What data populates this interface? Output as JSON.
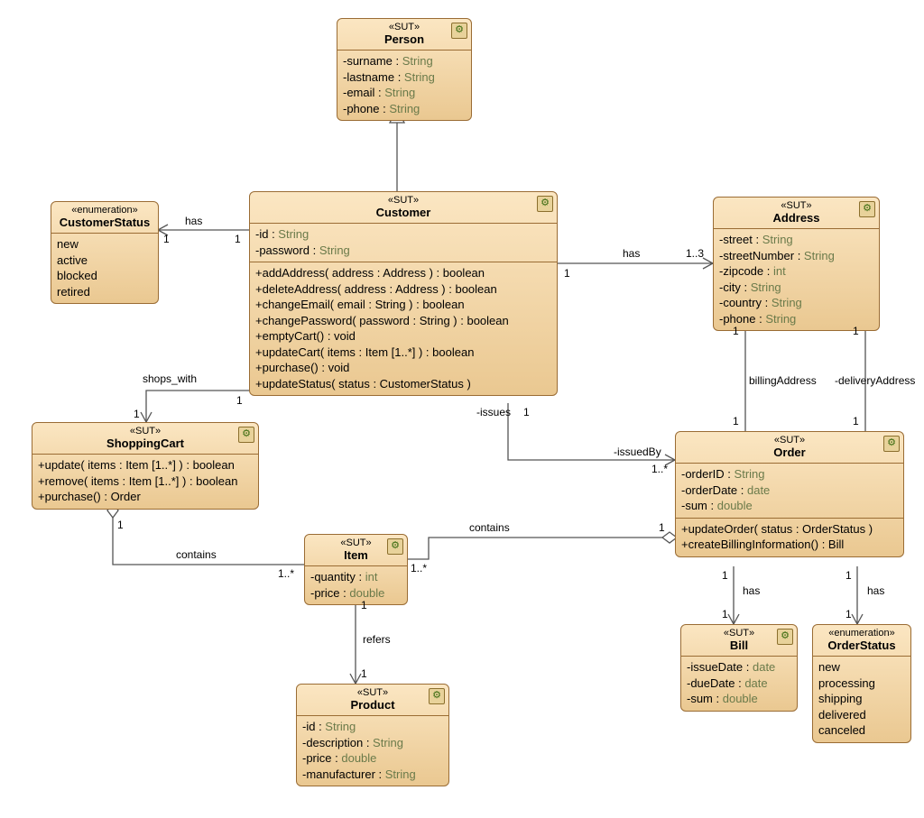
{
  "classes": {
    "Person": {
      "stereotype": "«SUT»",
      "name": "Person",
      "attributes": [
        {
          "name": "-surname",
          "type": "String"
        },
        {
          "name": "-lastname",
          "type": "String"
        },
        {
          "name": "-email",
          "type": "String"
        },
        {
          "name": "-phone",
          "type": "String"
        }
      ]
    },
    "CustomerStatus": {
      "stereotype": "«enumeration»",
      "name": "CustomerStatus",
      "literals": [
        "new",
        "active",
        "blocked",
        "retired"
      ]
    },
    "Customer": {
      "stereotype": "«SUT»",
      "name": "Customer",
      "attributes": [
        {
          "name": "-id",
          "type": "String"
        },
        {
          "name": "-password",
          "type": "String"
        }
      ],
      "operations": [
        "+addAddress( address : Address ) : boolean",
        "+deleteAddress( address : Address ) : boolean",
        "+changeEmail( email : String ) : boolean",
        "+changePassword( password : String ) : boolean",
        "+emptyCart() : void",
        "+updateCart( items : Item [1..*] ) : boolean",
        "+purchase() : void",
        "+updateStatus( status : CustomerStatus )"
      ]
    },
    "Address": {
      "stereotype": "«SUT»",
      "name": "Address",
      "attributes": [
        {
          "name": "-street",
          "type": "String"
        },
        {
          "name": "-streetNumber",
          "type": "String"
        },
        {
          "name": "-zipcode",
          "type": "int"
        },
        {
          "name": "-city",
          "type": "String"
        },
        {
          "name": "-country",
          "type": "String"
        },
        {
          "name": "-phone",
          "type": "String"
        }
      ]
    },
    "ShoppingCart": {
      "stereotype": "«SUT»",
      "name": "ShoppingCart",
      "operations": [
        "+update( items : Item [1..*] ) : boolean",
        "+remove( items : Item [1..*] ) : boolean",
        "+purchase() : Order"
      ]
    },
    "Order": {
      "stereotype": "«SUT»",
      "name": "Order",
      "attributes": [
        {
          "name": "-orderID",
          "type": "String"
        },
        {
          "name": "-orderDate",
          "type": "date"
        },
        {
          "name": "-sum",
          "type": "double"
        }
      ],
      "operations": [
        "+updateOrder( status : OrderStatus )",
        "+createBillingInformation() : Bill"
      ]
    },
    "Item": {
      "stereotype": "«SUT»",
      "name": "Item",
      "attributes": [
        {
          "name": "-quantity",
          "type": "int"
        },
        {
          "name": "-price",
          "type": "double"
        }
      ]
    },
    "Bill": {
      "stereotype": "«SUT»",
      "name": "Bill",
      "attributes": [
        {
          "name": "-issueDate",
          "type": "date"
        },
        {
          "name": "-dueDate",
          "type": "date"
        },
        {
          "name": "-sum",
          "type": "double"
        }
      ]
    },
    "OrderStatus": {
      "stereotype": "«enumeration»",
      "name": "OrderStatus",
      "literals": [
        "new",
        "processing",
        "shipping",
        "delivered",
        "canceled"
      ]
    },
    "Product": {
      "stereotype": "«SUT»",
      "name": "Product",
      "attributes": [
        {
          "name": "-id",
          "type": "String"
        },
        {
          "name": "-description",
          "type": "String"
        },
        {
          "name": "-price",
          "type": "double"
        },
        {
          "name": "-manufacturer",
          "type": "String"
        }
      ]
    }
  },
  "labels": {
    "has": "has",
    "shops_with": "shops_with",
    "issues": "-issues",
    "issuedBy": "-issuedBy",
    "billingAddress": "billingAddress",
    "deliveryAddress": "-deliveryAddress",
    "contains": "contains",
    "refers": "refers",
    "one": "1",
    "one_three": "1..3",
    "one_star": "1..*"
  }
}
